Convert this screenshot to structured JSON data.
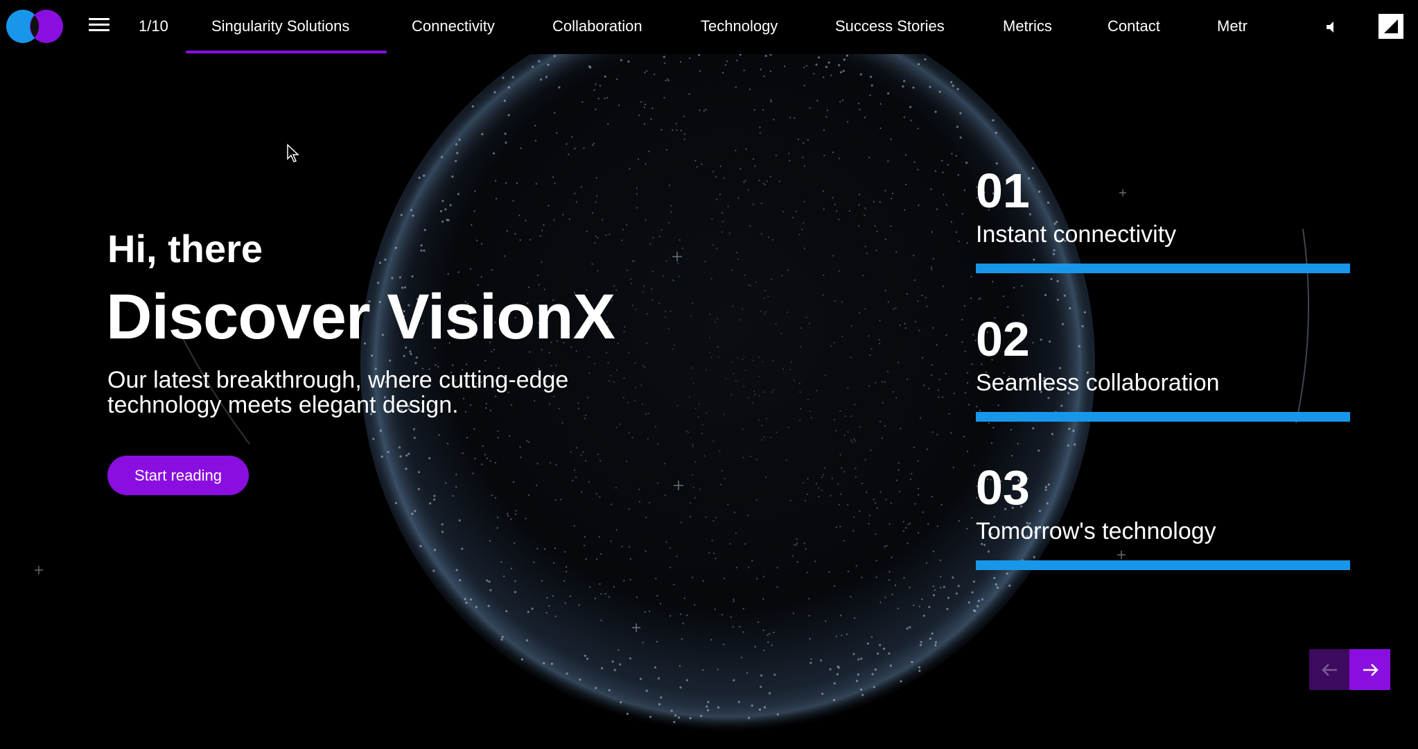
{
  "theme": {
    "accent": "#8a0ee0",
    "accent_dark": "#3c0a5e",
    "bar_color": "#1897ea",
    "logo_left": "#1897ea",
    "logo_right": "#8a0ee0"
  },
  "header": {
    "slide_counter": "1/10",
    "nav": [
      {
        "label": "Singularity Solutions",
        "active": true
      },
      {
        "label": "Connectivity"
      },
      {
        "label": "Collaboration"
      },
      {
        "label": "Technology"
      },
      {
        "label": "Success Stories"
      },
      {
        "label": "Metrics"
      },
      {
        "label": "Contact"
      },
      {
        "label": "Metr"
      }
    ],
    "icons": [
      "menu-icon",
      "speaker-icon",
      "fullscreen-icon"
    ]
  },
  "hero": {
    "greeting": "Hi, there",
    "headline": "Discover VisionX",
    "subtitle": "Our latest breakthrough, where cutting-edge technology meets elegant design.",
    "cta_label": "Start reading"
  },
  "features": [
    {
      "number": "01",
      "label": "Instant connectivity"
    },
    {
      "number": "02",
      "label": "Seamless collaboration"
    },
    {
      "number": "03",
      "label": "Tomorrow's technology"
    }
  ],
  "pager": {
    "prev_icon": "arrow-left-icon",
    "next_icon": "arrow-right-icon"
  }
}
